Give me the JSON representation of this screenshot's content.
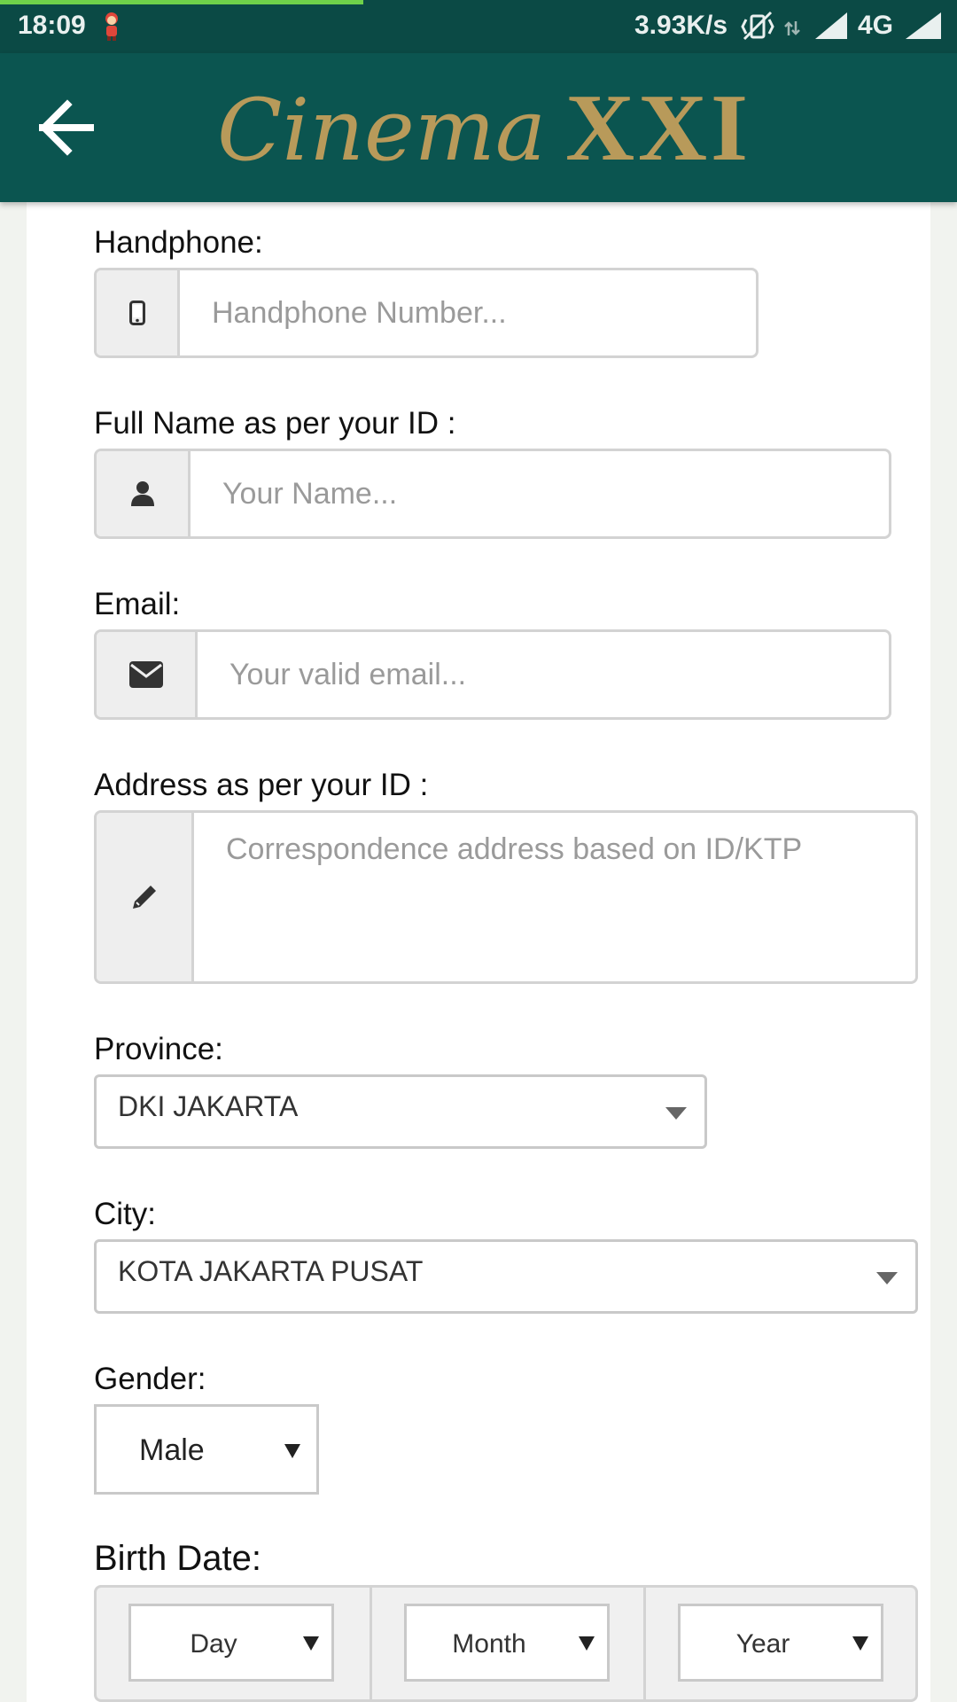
{
  "status_bar": {
    "time": "18:09",
    "speed": "3.93K/s",
    "network": "4G",
    "icons": [
      "app-mascot-icon",
      "vibrate-off-icon",
      "data-arrows-icon",
      "signal-icon",
      "signal-icon"
    ]
  },
  "app_bar": {
    "back_icon": "arrow-left-icon",
    "logo_script": "Cinema",
    "logo_mark": "XXI"
  },
  "form": {
    "handphone": {
      "label": "Handphone:",
      "placeholder": "Handphone Number...",
      "icon": "mobile-phone-icon"
    },
    "full_name": {
      "label": "Full Name as per your ID :",
      "placeholder": "Your Name...",
      "icon": "user-icon"
    },
    "email": {
      "label": "Email:",
      "placeholder": "Your valid email...",
      "icon": "envelope-icon"
    },
    "address": {
      "label": "Address as per your ID :",
      "placeholder": "Correspondence address based on ID/KTP",
      "icon": "pencil-icon"
    },
    "province": {
      "label": "Province:",
      "value": "DKI JAKARTA"
    },
    "city": {
      "label": "City:",
      "value": "KOTA JAKARTA PUSAT"
    },
    "gender": {
      "label": "Gender:",
      "value": "Male"
    },
    "birth_date": {
      "label": "Birth Date:",
      "day": "Day",
      "month": "Month",
      "year": "Year"
    }
  },
  "colors": {
    "status_bar": "#0b4a45",
    "app_bar": "#0b5550",
    "logo_gold": "#b89a5a",
    "page_bg": "#f1f3ef"
  }
}
